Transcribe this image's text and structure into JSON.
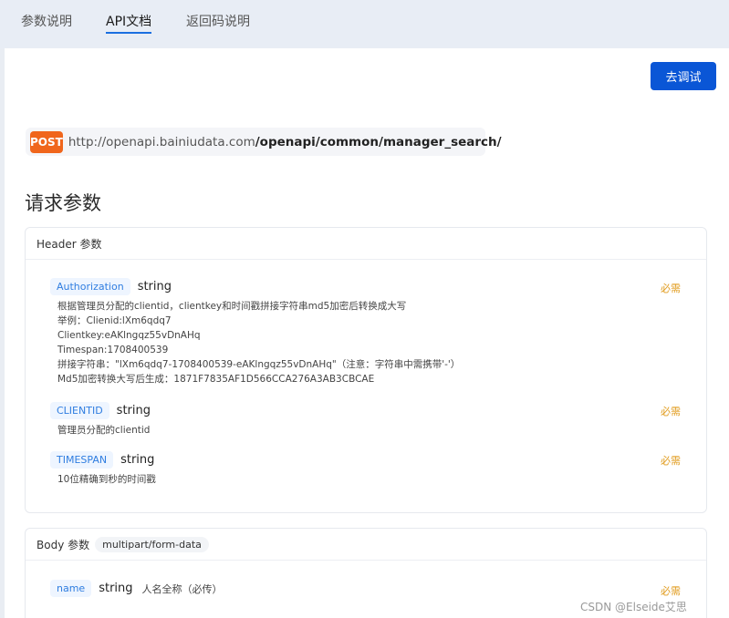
{
  "tabs": [
    {
      "label": "参数说明"
    },
    {
      "label": "API文档"
    },
    {
      "label": "返回码说明"
    }
  ],
  "try_button": "去调试",
  "endpoint": {
    "method": "POST",
    "base": "http://openapi.bainiudata.com",
    "path": "/openapi/common/manager_search/"
  },
  "section_title": "请求参数",
  "header_params": {
    "title": "Header 参数",
    "params": [
      {
        "name": "Authorization",
        "type": "string",
        "required": "必需",
        "desc": [
          "根据管理员分配的clientid，clientkey和时间戳拼接字符串md5加密后转换成大写",
          "举例：Clienid:lXm6qdq7",
          "Clientkey:eAKlngqz55vDnAHq",
          "Timespan:1708400539",
          "拼接字符串：\"lXm6qdq7-1708400539-eAKlngqz55vDnAHq\"（注意：字符串中需携带'-'）",
          "Md5加密转换大写后生成：1871F7835AF1D566CCA276A3AB3CBCAE"
        ]
      },
      {
        "name": "CLIENTID",
        "type": "string",
        "required": "必需",
        "desc": [
          "管理员分配的clientid"
        ]
      },
      {
        "name": "TIMESPAN",
        "type": "string",
        "required": "必需",
        "desc": [
          "10位精确到秒的时间戳"
        ]
      }
    ]
  },
  "body_params": {
    "title": "Body 参数",
    "content_type": "multipart/form-data",
    "params": [
      {
        "name": "name",
        "type": "string",
        "inline_desc": "人名全称（必传）",
        "required": "必需"
      }
    ]
  },
  "watermark": "CSDN @Elseide艾思"
}
